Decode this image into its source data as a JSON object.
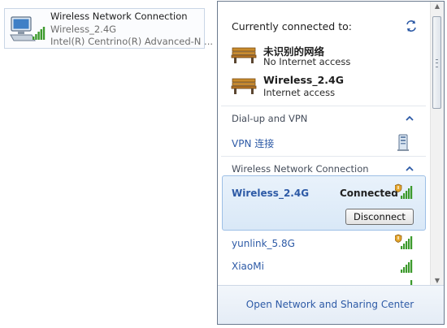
{
  "adapter": {
    "name": "Wireless Network Connection",
    "ssid": "Wireless_2.4G",
    "device": "Intel(R) Centrino(R) Advanced-N ..."
  },
  "popup": {
    "header": "Currently connected to:",
    "current_connections": [
      {
        "name": "未识别的网络",
        "status": "No Internet access"
      },
      {
        "name": "Wireless_2.4G",
        "status": "Internet access"
      }
    ],
    "dialup_section": {
      "title": "Dial-up and VPN",
      "items": [
        {
          "name": "VPN 连接"
        }
      ]
    },
    "wireless_section": {
      "title": "Wireless Network Connection"
    },
    "networks": [
      {
        "name": "Wireless_2.4G",
        "status": "Connected",
        "button": "Disconnect",
        "selected": true,
        "secured": true
      },
      {
        "name": "yunlink_5.8G",
        "secured": true
      },
      {
        "name": "XiaoMi",
        "secured": false
      }
    ],
    "footer_link": "Open Network and Sharing Center"
  },
  "colors": {
    "link": "#2d5aa6",
    "selection": "#d9e8f7",
    "signal": "#3c9a2c"
  },
  "icons": [
    "network-adapter-icon",
    "refresh-icon",
    "bench-icon",
    "collapse-chevron-icon",
    "vpn-icon",
    "signal-strength-icon",
    "security-shield-icon"
  ]
}
